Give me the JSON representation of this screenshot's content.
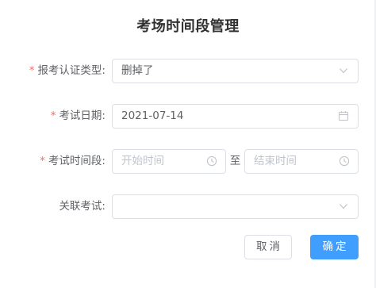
{
  "dialog": {
    "title": "考场时间段管理"
  },
  "form": {
    "required_mark": "*",
    "auth_type": {
      "label": "报考认证类型:",
      "value": "删掉了"
    },
    "exam_date": {
      "label": "考试日期:",
      "value": "2021-07-14"
    },
    "exam_time": {
      "label": "考试时间段:",
      "start_placeholder": "开始时间",
      "separator": "至",
      "end_placeholder": "结束时间"
    },
    "related_exam": {
      "label": "关联考试:",
      "value": ""
    }
  },
  "footer": {
    "cancel_label": "取消",
    "confirm_label": "确定"
  },
  "colors": {
    "primary": "#409eff",
    "required": "#f56c6c",
    "border": "#dcdfe6",
    "placeholder": "#c0c4cc"
  },
  "icons": {
    "auth_type": "chevron-down-icon",
    "exam_date": "calendar-icon",
    "time_start": "clock-icon",
    "time_end": "clock-icon",
    "related_exam": "chevron-down-icon"
  }
}
